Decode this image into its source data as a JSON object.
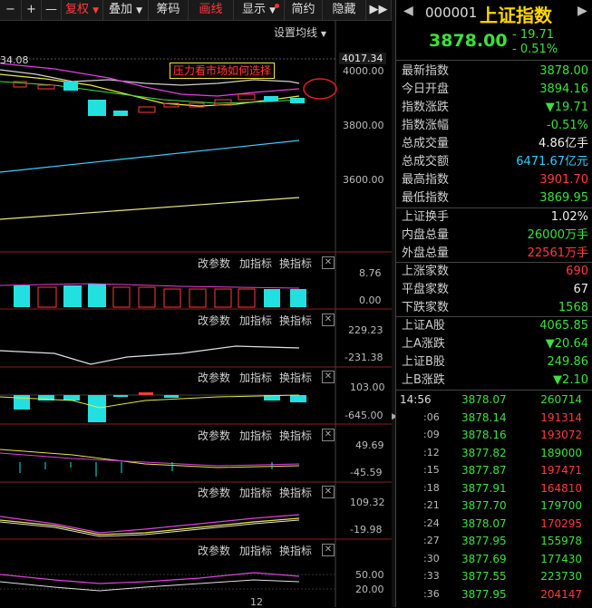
{
  "toolbar": {
    "minus": "−",
    "plus": "+",
    "dash": "—",
    "fuquan": "复权",
    "diejia": "叠加",
    "chouma": "筹码",
    "huaxian": "画线",
    "xianshi": "显示",
    "jianyue": "简约",
    "yincang": "隐藏"
  },
  "chart": {
    "ma_setting": "设置均线",
    "top_price": "4017.34",
    "left_price": "34.08",
    "annotation": "压力看市场如何选择",
    "axis_main": [
      "4000.00",
      "3800.00",
      "3600.00"
    ],
    "panel_ctrl": {
      "params": "改参数",
      "add": "加指标",
      "switch": "换指标",
      "close": "✕"
    },
    "axis_p1": [
      "8.76",
      "0.00"
    ],
    "axis_p2": [
      "229.23",
      "-231.38"
    ],
    "axis_p3": [
      "103.00",
      "-645.00"
    ],
    "axis_p4": [
      "49.69",
      "-45.59"
    ],
    "axis_p5": [
      "109.32",
      "-19.98"
    ],
    "axis_p6": [
      "50.00",
      "20.00"
    ],
    "bottom_label": "12"
  },
  "quote": {
    "code": "000001",
    "name": "上证指数",
    "price": "3878.00",
    "change": "- 19.71",
    "change_pct": "- 0.51%",
    "stats": [
      {
        "k": "最新指数",
        "v": "3878.00",
        "c": "#3ee03e"
      },
      {
        "k": "今日开盘",
        "v": "3894.16",
        "c": "#3ee03e"
      },
      {
        "k": "指数涨跌",
        "v": "▼19.71",
        "c": "#3ee03e"
      },
      {
        "k": "指数涨幅",
        "v": "-0.51%",
        "c": "#3ee03e"
      },
      {
        "k": "总成交量",
        "v": "4.86亿手",
        "c": "#eeeeee"
      },
      {
        "k": "总成交额",
        "v": "6471.67亿元",
        "c": "#33ccff"
      },
      {
        "k": "最高指数",
        "v": "3901.70",
        "c": "#ff3b3b"
      },
      {
        "k": "最低指数",
        "v": "3869.95",
        "c": "#3ee03e"
      },
      {
        "k": "上证换手",
        "v": "1.02%",
        "c": "#eeeeee"
      },
      {
        "k": "内盘总量",
        "v": "26000万手",
        "c": "#3ee03e"
      },
      {
        "k": "外盘总量",
        "v": "22561万手",
        "c": "#ff3b3b"
      },
      {
        "k": "上涨家数",
        "v": "690",
        "c": "#ff3b3b"
      },
      {
        "k": "平盘家数",
        "v": "67",
        "c": "#eeeeee"
      },
      {
        "k": "下跌家数",
        "v": "1568",
        "c": "#3ee03e"
      },
      {
        "k": "上证A股",
        "v": "4065.85",
        "c": "#3ee03e"
      },
      {
        "k": "上A涨跌",
        "v": "▼20.64",
        "c": "#3ee03e"
      },
      {
        "k": "上证B股",
        "v": "249.86",
        "c": "#3ee03e"
      },
      {
        "k": "上B涨跌",
        "v": "▼2.10",
        "c": "#3ee03e"
      }
    ],
    "ticks": [
      {
        "t": "14:56",
        "p": "3878.07",
        "v": "260714",
        "c": "#3ee03e"
      },
      {
        "t": ":06",
        "p": "3878.14",
        "v": "191314",
        "c": "#ff3b3b"
      },
      {
        "t": ":09",
        "p": "3878.16",
        "v": "193072",
        "c": "#ff3b3b"
      },
      {
        "t": ":12",
        "p": "3877.82",
        "v": "189000",
        "c": "#3ee03e"
      },
      {
        "t": ":15",
        "p": "3877.87",
        "v": "197471",
        "c": "#ff3b3b"
      },
      {
        "t": ":18",
        "p": "3877.91",
        "v": "164810",
        "c": "#ff3b3b"
      },
      {
        "t": ":21",
        "p": "3877.70",
        "v": "179700",
        "c": "#3ee03e"
      },
      {
        "t": ":24",
        "p": "3878.07",
        "v": "170295",
        "c": "#ff3b3b"
      },
      {
        "t": ":27",
        "p": "3877.95",
        "v": "155978",
        "c": "#3ee03e"
      },
      {
        "t": ":30",
        "p": "3877.69",
        "v": "177430",
        "c": "#3ee03e"
      },
      {
        "t": ":33",
        "p": "3877.55",
        "v": "223730",
        "c": "#3ee03e"
      },
      {
        "t": ":36",
        "p": "3877.95",
        "v": "204147",
        "c": "#ff3b3b"
      }
    ]
  }
}
